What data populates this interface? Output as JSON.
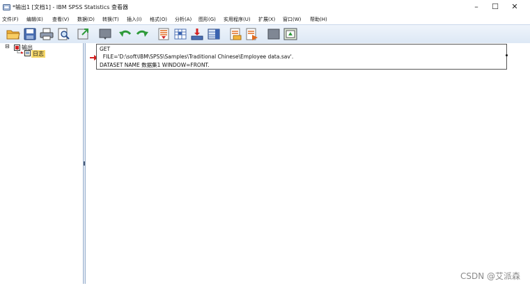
{
  "window": {
    "title": "*输出1 [文档1] - IBM SPSS Statistics 查看器",
    "controls": {
      "minimize": "–",
      "maximize": "☐",
      "close": "✕"
    }
  },
  "menu": [
    "文件(F)",
    "编辑(E)",
    "查看(V)",
    "数据(D)",
    "转换(T)",
    "插入(I)",
    "格式(O)",
    "分析(A)",
    "图形(G)",
    "实用程序(U)",
    "扩展(X)",
    "窗口(W)",
    "帮助(H)"
  ],
  "toolbar": {
    "icons": [
      "open-folder-icon",
      "save-icon",
      "print-icon",
      "print-preview-icon",
      "export-icon",
      "recall-dialog-icon",
      "undo-icon",
      "redo-icon",
      "goto-data-icon",
      "goto-case-icon",
      "goto-variable-icon",
      "variables-icon",
      "show-all-icon",
      "designate-window-icon",
      "blank-icon",
      "select-output-icon"
    ]
  },
  "tree": {
    "root_label": "输出",
    "child_label": "日志",
    "expander": "⊟"
  },
  "log": {
    "lines": [
      "GET",
      "  FILE='D:\\soft\\IBM\\SPSS\\Samples\\Traditional Chinese\\Employee data.sav'.",
      "DATASET NAME 数据集1 WINDOW=FRONT."
    ]
  },
  "watermark": "CSDN @艾派森",
  "colors": {
    "accent": "#2b64b6",
    "arrow": "#d42222",
    "toolbar_bg": "#dde8f5"
  }
}
